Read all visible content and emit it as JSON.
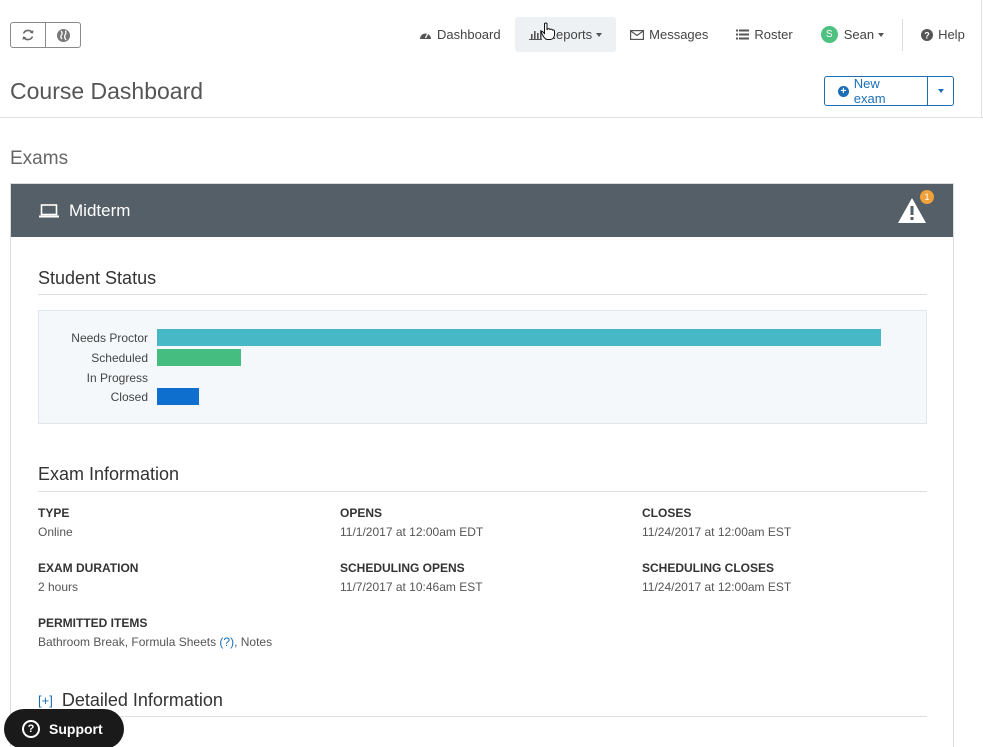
{
  "toolbar": {
    "refresh_icon": "refresh-icon",
    "globe_icon": "globe-icon"
  },
  "nav": {
    "dashboard": "Dashboard",
    "reports": "Reports",
    "messages": "Messages",
    "roster": "Roster",
    "user_initial": "S",
    "user_name": "Sean",
    "help": "Help"
  },
  "page": {
    "title": "Course Dashboard",
    "new_exam": "New exam",
    "section": "Exams"
  },
  "exam": {
    "name": "Midterm",
    "alert_count": "1",
    "student_status_title": "Student Status",
    "status_rows": [
      {
        "label": "Needs Proctor",
        "value": 100,
        "color": "#47b8c6"
      },
      {
        "label": "Scheduled",
        "value": 11.6,
        "color": "#46bd80"
      },
      {
        "label": "In Progress",
        "value": 0,
        "color": "#3a7fc9"
      },
      {
        "label": "Closed",
        "value": 5.8,
        "color": "#0f6fce"
      }
    ],
    "info_title": "Exam Information",
    "info": {
      "type_key": "TYPE",
      "type_val": "Online",
      "opens_key": "OPENS",
      "opens_val": "11/1/2017 at 12:00am EDT",
      "closes_key": "CLOSES",
      "closes_val": "11/24/2017 at 12:00am EST",
      "duration_key": "EXAM DURATION",
      "duration_val": "2 hours",
      "sched_opens_key": "SCHEDULING OPENS",
      "sched_opens_val": "11/7/2017 at 10:46am EST",
      "sched_closes_key": "SCHEDULING CLOSES",
      "sched_closes_val": "11/24/2017 at 12:00am EST",
      "permitted_key": "PERMITTED ITEMS",
      "permitted_a": "Bathroom Break, Formula Sheets",
      "permitted_q": "(?)",
      "permitted_b": ", Notes"
    },
    "detail_toggle": "[+]",
    "detail_title": "Detailed Information"
  },
  "support": {
    "label": "Support"
  }
}
